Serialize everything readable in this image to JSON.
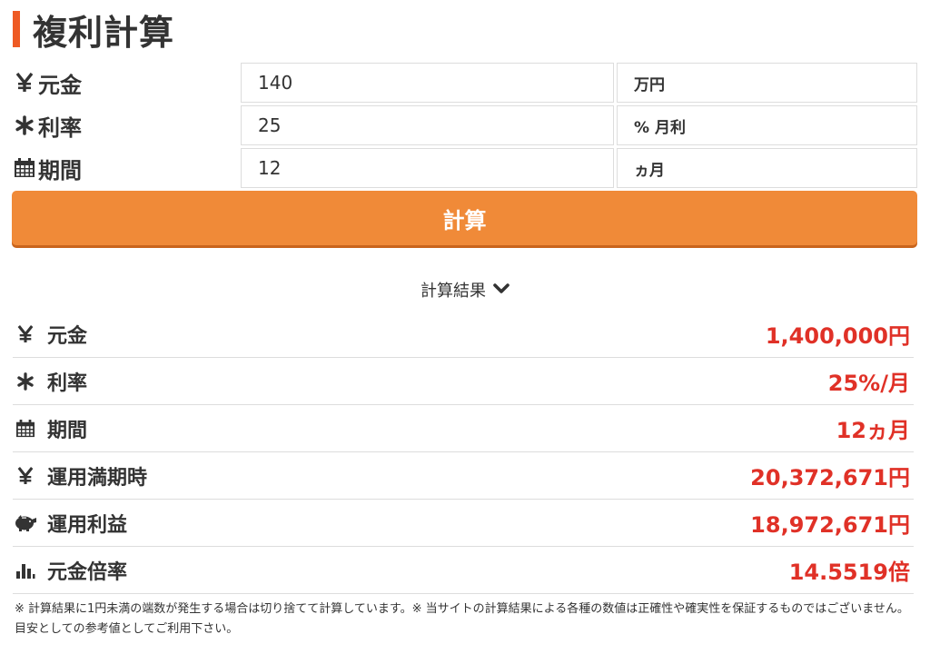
{
  "title": "複利計算",
  "form": {
    "principal": {
      "label": "元金",
      "value": "140",
      "unit": "万円",
      "icon": "yen-icon"
    },
    "rate": {
      "label": "利率",
      "value": "25",
      "unit": "% 月利",
      "icon": "asterisk-icon"
    },
    "period": {
      "label": "期間",
      "value": "12",
      "unit": "ヵ月",
      "icon": "calendar-icon"
    }
  },
  "calculate_label": "計算",
  "results_heading": "計算結果",
  "results": [
    {
      "label": "元金",
      "value": "1,400,000円",
      "icon": "yen-icon"
    },
    {
      "label": "利率",
      "value": "25%/月",
      "icon": "asterisk-icon"
    },
    {
      "label": "期間",
      "value": "12ヵ月",
      "icon": "calendar-icon"
    },
    {
      "label": "運用満期時",
      "value": "20,372,671円",
      "icon": "yen-icon"
    },
    {
      "label": "運用利益",
      "value": "18,972,671円",
      "icon": "piggy-bank-icon"
    },
    {
      "label": "元金倍率",
      "value": "14.5519倍",
      "icon": "bar-chart-icon"
    }
  ],
  "note": "※ 計算結果に1円未満の端数が発生する場合は切り捨てて計算しています。※ 当サイトの計算結果による各種の数値は正確性や確実性を保証するものではございません。目安としての参考値としてご利用下さい。",
  "colors": {
    "accent_bar": "#ee5a24",
    "button": "#f08a38",
    "result_value": "#e03127"
  }
}
